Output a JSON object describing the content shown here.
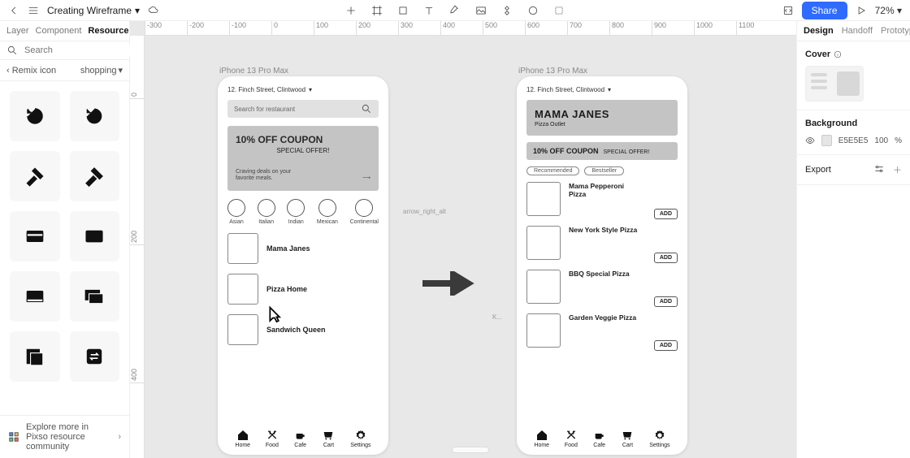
{
  "toolbar": {
    "doc_title": "Creating Wireframe",
    "share_label": "Share",
    "zoom": "72%"
  },
  "left_panel": {
    "tabs": [
      "Layer",
      "Component",
      "Resource"
    ],
    "active_tab": 2,
    "search_placeholder": "Search",
    "crumb_back": "Remix icon",
    "crumb_category": "shopping",
    "footer": "Explore more in Pixso resource community"
  },
  "ruler_h": [
    "-300",
    "-200",
    "-100",
    "0",
    "100",
    "200",
    "300",
    "400",
    "500",
    "600",
    "700",
    "800",
    "900",
    "1000",
    "1100"
  ],
  "ruler_v": [
    "0",
    "200",
    "400"
  ],
  "canvas": {
    "frame_a_label": "iPhone 13 Pro Max",
    "frame_b_label": "iPhone 13 Pro Max",
    "arrow_label": "arrow_right_alt",
    "k_label": "K..."
  },
  "frame_a": {
    "address": "12. Finch Street, Clintwood",
    "search_placeholder": "Search for restaurant",
    "coupon_title": "10% OFF COUPON",
    "coupon_special": "SPECIAL OFFER!",
    "coupon_footer": "Craving deals on your favorite meals.",
    "categories": [
      "Asian",
      "Italian",
      "Indian",
      "Mexican",
      "Continental"
    ],
    "restaurants": [
      "Mama Janes",
      "Pizza Home",
      "Sandwich Queen"
    ],
    "nav": [
      "Home",
      "Food",
      "Cafe",
      "Cart",
      "Settings"
    ]
  },
  "frame_b": {
    "address": "12. Finch Street, Clintwood",
    "header_title": "MAMA JANES",
    "header_sub": "Pizza Outlet",
    "coupon_title": "10% OFF COUPON",
    "coupon_special": "SPECIAL OFFER!",
    "chips": [
      "Recommended",
      "Bestseller"
    ],
    "menu": [
      "Mama Pepperoni Pizza",
      "New York Style Pizza",
      "BBQ Special Pizza",
      "Garden Veggie Pizza"
    ],
    "add_label": "ADD",
    "nav": [
      "Home",
      "Food",
      "Cafe",
      "Cart",
      "Settings"
    ]
  },
  "right_panel": {
    "tabs": [
      "Design",
      "Handoff",
      "Prototype"
    ],
    "active_tab": 0,
    "cover_label": "Cover",
    "background_label": "Background",
    "bg_value": "E5E5E5",
    "bg_opacity": "100",
    "bg_opacity_unit": "%",
    "export_label": "Export"
  }
}
